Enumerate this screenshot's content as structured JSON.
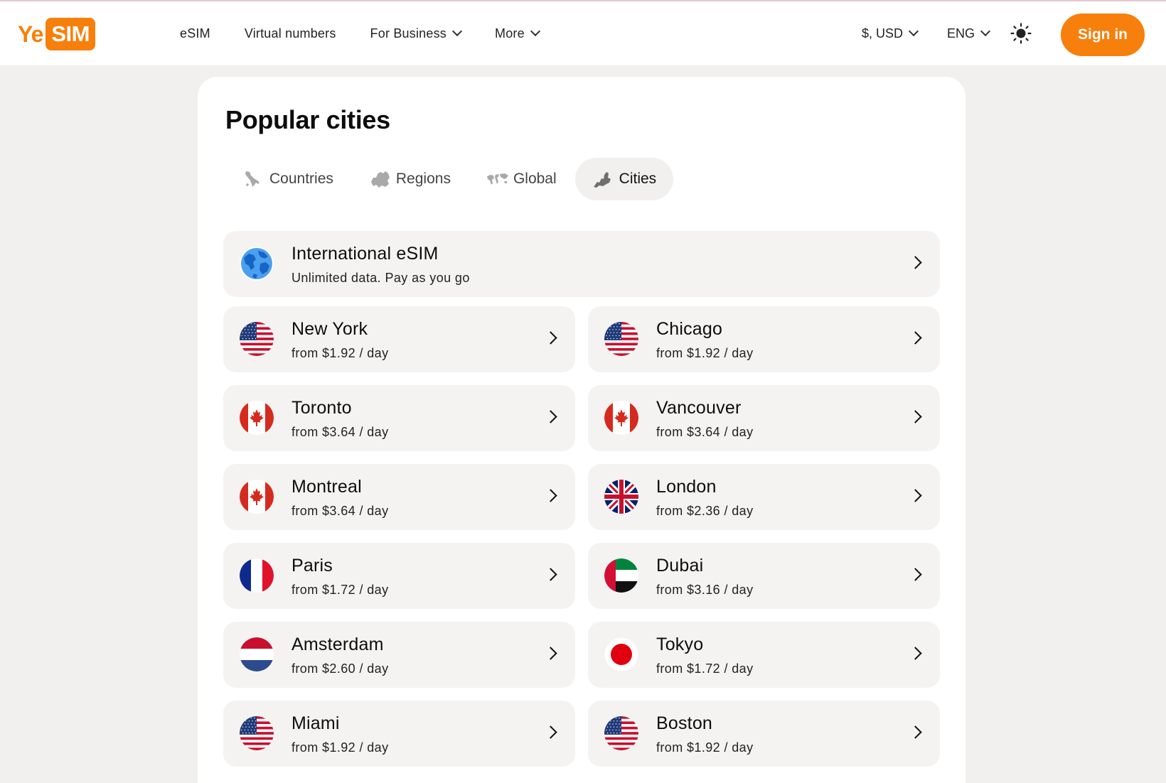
{
  "header": {
    "logo_ye": "Ye",
    "logo_sim": "SIM",
    "nav": [
      {
        "label": "eSIM",
        "dropdown": false
      },
      {
        "label": "Virtual numbers",
        "dropdown": false
      },
      {
        "label": "For Business",
        "dropdown": true
      },
      {
        "label": "More",
        "dropdown": true
      }
    ],
    "currency": "$, USD",
    "language": "ENG",
    "theme_icon": "sun-icon",
    "sign_in": "Sign in"
  },
  "main": {
    "title": "Popular cities",
    "tabs": [
      {
        "label": "Countries",
        "icon": "italy-map-icon",
        "active": false
      },
      {
        "label": "Regions",
        "icon": "europe-map-icon",
        "active": false
      },
      {
        "label": "Global",
        "icon": "world-map-icon",
        "active": false
      },
      {
        "label": "Cities",
        "icon": "city-map-icon",
        "active": true
      }
    ],
    "international": {
      "name": "International eSIM",
      "subtitle": "Unlimited data. Pay as you go",
      "icon": "globe-icon"
    },
    "cities": [
      {
        "name": "New York",
        "price": "from $1.92 / day",
        "flag": "us"
      },
      {
        "name": "Chicago",
        "price": "from $1.92 / day",
        "flag": "us"
      },
      {
        "name": "Toronto",
        "price": "from $3.64 / day",
        "flag": "ca"
      },
      {
        "name": "Vancouver",
        "price": "from $3.64 / day",
        "flag": "ca"
      },
      {
        "name": "Montreal",
        "price": "from $3.64 / day",
        "flag": "ca"
      },
      {
        "name": "London",
        "price": "from $2.36 / day",
        "flag": "gb"
      },
      {
        "name": "Paris",
        "price": "from $1.72 / day",
        "flag": "fr"
      },
      {
        "name": "Dubai",
        "price": "from $3.16 / day",
        "flag": "ae"
      },
      {
        "name": "Amsterdam",
        "price": "from $2.60 / day",
        "flag": "nl"
      },
      {
        "name": "Tokyo",
        "price": "from $1.72 / day",
        "flag": "jp"
      },
      {
        "name": "Miami",
        "price": "from $1.92 / day",
        "flag": "us"
      },
      {
        "name": "Boston",
        "price": "from $1.92 / day",
        "flag": "us"
      }
    ]
  },
  "colors": {
    "accent": "#f77f0b",
    "page_bg": "#f1f0ee",
    "row_bg": "#f4f3f1"
  }
}
